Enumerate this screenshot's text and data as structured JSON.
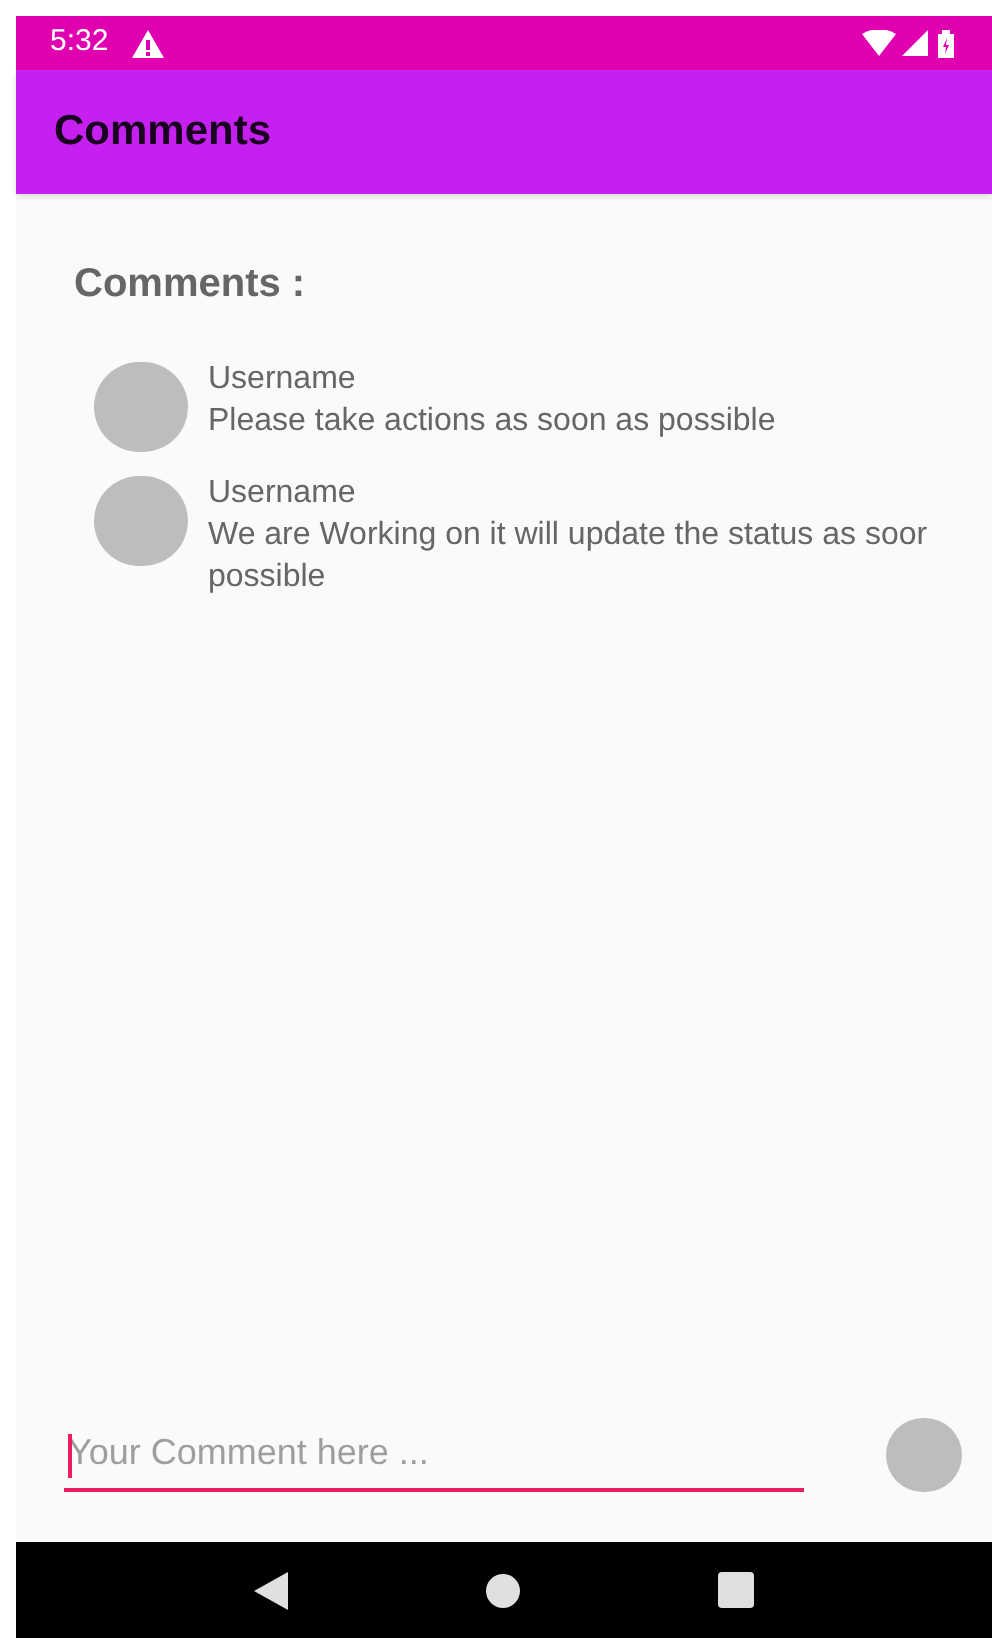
{
  "status_bar": {
    "time": "5:32"
  },
  "app_bar": {
    "title": "Comments"
  },
  "section": {
    "heading": "Comments :"
  },
  "comments": [
    {
      "username": "Username",
      "lines": [
        "Please take actions as soon as possible"
      ]
    },
    {
      "username": "Username",
      "lines": [
        "We are Working on it will update the status as soor",
        "possible"
      ]
    }
  ],
  "composer": {
    "placeholder": "Your Comment here ...",
    "focused": true
  }
}
